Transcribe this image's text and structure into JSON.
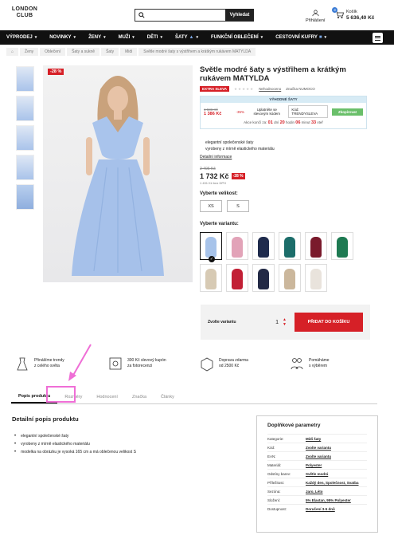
{
  "header": {
    "logo_line1": "LONDON",
    "logo_line2": "CLUB",
    "search_placeholder": "",
    "search_button": "Vyhledat",
    "login_label": "Přihlášení",
    "cart_label": "Košík",
    "cart_price": "5 636,40 Kč",
    "cart_count": "3"
  },
  "nav": [
    {
      "label": "VÝPRODEJ"
    },
    {
      "label": "NOVINKY"
    },
    {
      "label": "ŽENY"
    },
    {
      "label": "MUŽI"
    },
    {
      "label": "DĚTI"
    },
    {
      "label": "ŠATY"
    },
    {
      "label": "FUNKČNÍ OBLEČENÍ"
    },
    {
      "label": "CESTOVNÍ KUFRY"
    }
  ],
  "breadcrumbs": [
    "Ženy",
    "Oblečení",
    "Šaty a sukně",
    "Šaty",
    "Midi",
    "Světle modré šaty s výstřihem a krátkým rukávem MATYLDA"
  ],
  "product": {
    "sale_badge": "-28 %",
    "title": "Světle modré šaty s výstřihem a krátkým rukávem MATYLDA",
    "tag_extra": "EXTRA SLEVA",
    "tag_reviews": "Nehodnoceno",
    "tag_brand": "Značka NUMOCO",
    "deal_header": "VÝHODNÉ ŠATY",
    "deal_old_price": "1 586 Kč",
    "deal_pct": "-35%",
    "deal_new_price": "1 386 Kč",
    "deal_text": "Uplatněte se slevovým kódem",
    "deal_code": "Kód: TRENDYSLEVA",
    "deal_button": "Zkopírovat",
    "countdown_label": "Akce končí za:",
    "cd_days": "01",
    "cd_days_l": "dní",
    "cd_hours": "20",
    "cd_hours_l": "hodin",
    "cd_min": "06",
    "cd_min_l": "minut",
    "cd_sec": "33",
    "cd_sec_l": "vteř",
    "bullet1": "elegantní společenské šaty",
    "bullet2": "vyrobeny z mírně elastického materiálu",
    "details_link": "Detailní informace",
    "old_price": "2 406 Kč",
    "price": "1 732 Kč",
    "price_pct": "-28 %",
    "vat": "1 431 Kč bez DPH",
    "size_label": "Vyberte velikost:",
    "sizes": [
      "XS",
      "S"
    ],
    "variant_label": "Vyberte variantu:",
    "variant_colors": [
      "#a7c3ea",
      "#e2a3b8",
      "#1f2b4d",
      "#1c6d6a",
      "#7a1a2c",
      "#1e7a52",
      "#d7cab4",
      "#c21f35",
      "#232a46",
      "#cbb79c",
      "#e9e3dc"
    ],
    "buy_variant_label": "Zvolte variantu",
    "qty": "1",
    "add_to_cart": "PŘIDAT DO KOŠÍKU"
  },
  "usps": [
    {
      "line1": "Přinášíme trendy",
      "line2": "z celého světa"
    },
    {
      "line1": "300 Kč slevový kupón",
      "line2": "za fotorecenzi"
    },
    {
      "line1": "Doprava zdarma",
      "line2": "od 2500 Kč"
    },
    {
      "line1": "Pomáháme",
      "line2": "s výběrem"
    }
  ],
  "tabs": [
    "Popis produktu",
    "Rozměry",
    "Hodnocení",
    "Značka",
    "Články"
  ],
  "description": {
    "heading": "Detailní popis produktu",
    "items": [
      "elegantní společenské šaty",
      "vyrobeny z mírně elastického materiálu",
      "modelka na obrázku je vysoká 165 cm a má oblečenou velikost S"
    ]
  },
  "params": {
    "heading": "Doplňkové parametry",
    "rows": [
      {
        "k": "Kategorie:",
        "v": "Midi šaty"
      },
      {
        "k": "Kód:",
        "v": "Zvolte variantu"
      },
      {
        "k": "EAN:",
        "v": "Zvolte variantu"
      },
      {
        "k": "Materiál:",
        "v": "Polyester"
      },
      {
        "k": "Odstíny barev:",
        "v": "Světle modrá"
      },
      {
        "k": "Příležitost:",
        "v": "Každý den, Společnost, Svatba"
      },
      {
        "k": "Sezóna:",
        "v": "Jaro, Léto"
      },
      {
        "k": "Složení:",
        "v": "5% Elastan, 95% Polyester"
      },
      {
        "k": "Dostupnost:",
        "v": "Doručení 3-5 dnů"
      }
    ]
  },
  "colors": {
    "accent_red": "#d62027",
    "nav_bg": "#111111",
    "highlight": "#ef6ed6",
    "cta_green": "#6abf6a"
  }
}
